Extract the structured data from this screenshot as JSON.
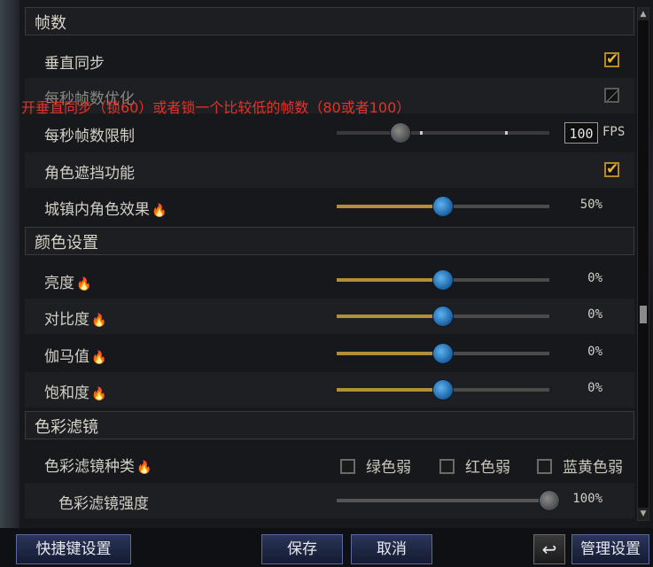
{
  "overlay": {
    "note": "开垂直同步（锁60）或者锁一个比较低的帧数（80或者100）"
  },
  "sections": {
    "framerate": "帧数",
    "color": "颜色设置",
    "filter": "色彩滤镜"
  },
  "settings": {
    "vsync": {
      "label": "垂直同步",
      "checked": true
    },
    "fps_opt": {
      "label": "每秒帧数优化",
      "checked": false,
      "disabled": true
    },
    "fps_limit": {
      "label": "每秒帧数限制",
      "value": "100",
      "unit": "FPS",
      "level": 0.3
    },
    "occlusion": {
      "label": "角色遮挡功能",
      "checked": true
    },
    "town_effect": {
      "label": "城镇内角色效果",
      "value": "50%",
      "level": 0.5
    },
    "brightness": {
      "label": "亮度",
      "value": "0%",
      "level": 0.5
    },
    "contrast": {
      "label": "对比度",
      "value": "0%",
      "level": 0.5
    },
    "gamma": {
      "label": "伽马值",
      "value": "0%",
      "level": 0.5
    },
    "saturation": {
      "label": "饱和度",
      "value": "0%",
      "level": 0.5
    },
    "filter_type": {
      "label": "色彩滤镜种类",
      "options": [
        "绿色弱",
        "红色弱",
        "蓝黄色弱"
      ]
    },
    "filter_strength": {
      "label": "色彩滤镜强度",
      "value": "100%",
      "level": 1.0
    }
  },
  "buttons": {
    "shortcuts": "快捷键设置",
    "save": "保存",
    "cancel": "取消",
    "reset_icon": "undo-icon",
    "manage": "管理设置"
  },
  "colors": {
    "accent": "#b48f3a",
    "overlay_text": "#e0342a",
    "knob": "#2f8ae0"
  }
}
